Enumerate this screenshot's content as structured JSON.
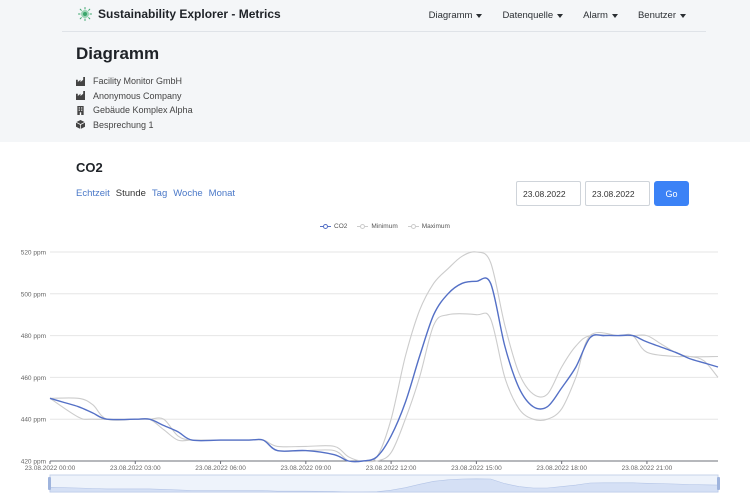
{
  "app": {
    "title": "Sustainability Explorer - Metrics"
  },
  "nav": {
    "items": [
      {
        "label": "Diagramm"
      },
      {
        "label": "Datenquelle"
      },
      {
        "label": "Alarm"
      },
      {
        "label": "Benutzer"
      }
    ]
  },
  "page": {
    "title": "Diagramm",
    "info": [
      {
        "icon": "factory-icon",
        "text": "Facility Monitor GmbH"
      },
      {
        "icon": "factory-icon",
        "text": "Anonymous Company"
      },
      {
        "icon": "building-icon",
        "text": "Gebäude Komplex Alpha"
      },
      {
        "icon": "cube-icon",
        "text": "Besprechung 1"
      }
    ]
  },
  "section": {
    "title": "CO2"
  },
  "periods": [
    {
      "label": "Echtzeit",
      "active": false
    },
    {
      "label": "Stunde",
      "active": true
    },
    {
      "label": "Tag",
      "active": false
    },
    {
      "label": "Woche",
      "active": false
    },
    {
      "label": "Monat",
      "active": false
    }
  ],
  "date_range": {
    "from": "23.08.2022",
    "to": "23.08.2022",
    "go_label": "Go"
  },
  "colors": {
    "accent": "#3b82f6",
    "co2_line": "#5470c6",
    "minmax_line": "#cccccc"
  },
  "chart_data": {
    "type": "line",
    "legend_position": "top-center",
    "grid": true,
    "y_unit": "ppm",
    "ylim": [
      420,
      520
    ],
    "y_ticks": [
      420,
      440,
      460,
      480,
      500,
      520
    ],
    "y_tick_labels": [
      "420 ppm",
      "440 ppm",
      "460 ppm",
      "480 ppm",
      "500 ppm",
      "520 ppm"
    ],
    "xlim_hours": [
      0,
      23.5
    ],
    "x_tick_hours": [
      0,
      3,
      6,
      9,
      12,
      15,
      18,
      21
    ],
    "x_tick_labels": [
      "23.08.2022 00:00",
      "23.08.2022 03:00",
      "23.08.2022 06:00",
      "23.08.2022 09:00",
      "23.08.2022 12:00",
      "23.08.2022 15:00",
      "23.08.2022 18:00",
      "23.08.2022 21:00"
    ],
    "series": [
      {
        "name": "CO2",
        "color": "#5470c6",
        "points": [
          [
            0,
            450
          ],
          [
            0.5,
            448
          ],
          [
            1,
            446
          ],
          [
            1.5,
            443
          ],
          [
            2,
            440
          ],
          [
            3,
            440
          ],
          [
            3.5,
            440
          ],
          [
            4,
            437
          ],
          [
            4.5,
            434
          ],
          [
            5,
            430
          ],
          [
            6,
            430
          ],
          [
            7,
            430
          ],
          [
            7.5,
            430
          ],
          [
            8,
            425
          ],
          [
            9,
            425
          ],
          [
            10,
            423
          ],
          [
            10.5,
            420
          ],
          [
            11,
            420
          ],
          [
            11.5,
            422
          ],
          [
            12,
            432
          ],
          [
            12.5,
            448
          ],
          [
            13,
            470
          ],
          [
            13.5,
            490
          ],
          [
            14,
            500
          ],
          [
            14.5,
            505
          ],
          [
            15,
            506
          ],
          [
            15.5,
            505
          ],
          [
            16,
            475
          ],
          [
            16.5,
            455
          ],
          [
            17,
            446
          ],
          [
            17.5,
            446
          ],
          [
            18,
            455
          ],
          [
            18.5,
            465
          ],
          [
            19,
            479
          ],
          [
            19.5,
            480
          ],
          [
            20,
            480
          ],
          [
            20.5,
            480
          ],
          [
            21,
            477
          ],
          [
            22,
            472
          ],
          [
            22.5,
            469
          ],
          [
            23,
            467
          ],
          [
            23.5,
            465
          ]
        ]
      },
      {
        "name": "Minimum",
        "color": "#cccccc",
        "points": [
          [
            0,
            450
          ],
          [
            1,
            441
          ],
          [
            1.5,
            440
          ],
          [
            3,
            440
          ],
          [
            3.5,
            440
          ],
          [
            4,
            435
          ],
          [
            4.5,
            430
          ],
          [
            5,
            430
          ],
          [
            6,
            430
          ],
          [
            7,
            430
          ],
          [
            7.5,
            430
          ],
          [
            8,
            425
          ],
          [
            9,
            425
          ],
          [
            10,
            425
          ],
          [
            10.5,
            420
          ],
          [
            11,
            420
          ],
          [
            11.5,
            420
          ],
          [
            12,
            424
          ],
          [
            12.5,
            440
          ],
          [
            13,
            460
          ],
          [
            13.5,
            485
          ],
          [
            14,
            490
          ],
          [
            15,
            490
          ],
          [
            15.5,
            488
          ],
          [
            16,
            460
          ],
          [
            16.5,
            445
          ],
          [
            17,
            440
          ],
          [
            17.5,
            440
          ],
          [
            18,
            445
          ],
          [
            18.5,
            460
          ],
          [
            19,
            480
          ],
          [
            20,
            480
          ],
          [
            20.5,
            480
          ],
          [
            21,
            472
          ],
          [
            22,
            470
          ],
          [
            22.5,
            470
          ],
          [
            23,
            468
          ],
          [
            23.5,
            460
          ]
        ]
      },
      {
        "name": "Maximum",
        "color": "#cccccc",
        "points": [
          [
            0,
            450
          ],
          [
            1,
            450
          ],
          [
            1.5,
            447
          ],
          [
            2,
            440
          ],
          [
            3,
            440
          ],
          [
            3.5,
            440
          ],
          [
            4,
            440
          ],
          [
            4.5,
            432
          ],
          [
            5,
            430
          ],
          [
            6,
            430
          ],
          [
            7,
            430
          ],
          [
            7.5,
            430
          ],
          [
            8,
            427
          ],
          [
            9,
            427
          ],
          [
            10,
            427
          ],
          [
            10.5,
            422
          ],
          [
            11,
            420
          ],
          [
            11.5,
            422
          ],
          [
            12,
            440
          ],
          [
            12.5,
            470
          ],
          [
            13,
            492
          ],
          [
            13.5,
            505
          ],
          [
            14,
            512
          ],
          [
            14.5,
            518
          ],
          [
            15,
            520
          ],
          [
            15.5,
            515
          ],
          [
            16,
            485
          ],
          [
            16.5,
            462
          ],
          [
            17,
            452
          ],
          [
            17.5,
            452
          ],
          [
            18,
            465
          ],
          [
            18.5,
            475
          ],
          [
            19,
            480
          ],
          [
            20,
            480
          ],
          [
            20.5,
            480
          ],
          [
            21,
            480
          ],
          [
            21.5,
            476
          ],
          [
            22,
            472
          ],
          [
            22.5,
            470
          ],
          [
            23.5,
            470
          ]
        ]
      }
    ]
  }
}
